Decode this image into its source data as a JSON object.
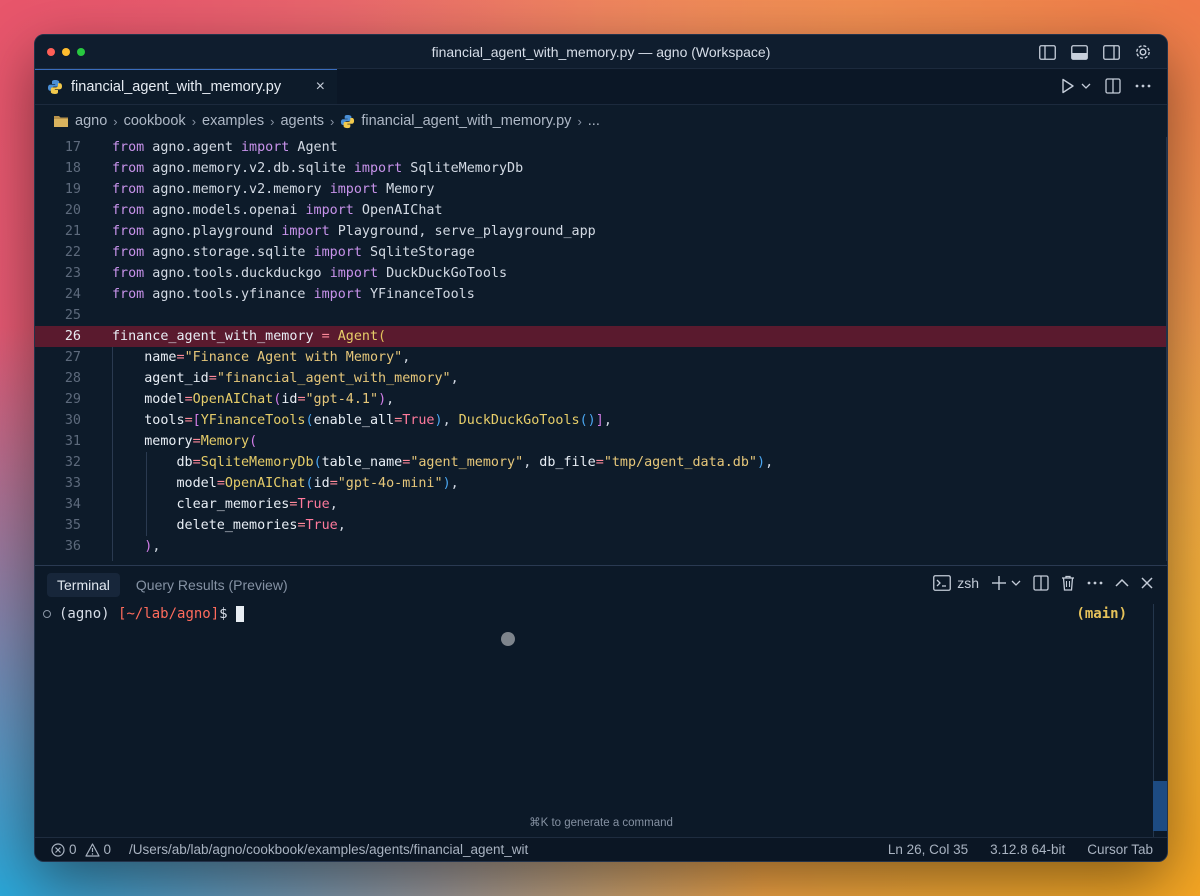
{
  "window": {
    "title": "financial_agent_with_memory.py — agno (Workspace)"
  },
  "tab": {
    "filename": "financial_agent_with_memory.py",
    "close": "×"
  },
  "breadcrumb": {
    "items": [
      "agno",
      "cookbook",
      "examples",
      "agents",
      "financial_agent_with_memory.py",
      "..."
    ]
  },
  "editor": {
    "active_line": 26,
    "lines": [
      {
        "n": "17"
      },
      {
        "n": "18"
      },
      {
        "n": "19"
      },
      {
        "n": "20"
      },
      {
        "n": "21"
      },
      {
        "n": "22"
      },
      {
        "n": "23"
      },
      {
        "n": "24"
      },
      {
        "n": "25"
      },
      {
        "n": "26"
      },
      {
        "n": "27"
      },
      {
        "n": "28"
      },
      {
        "n": "29"
      },
      {
        "n": "30"
      },
      {
        "n": "31"
      },
      {
        "n": "32"
      },
      {
        "n": "33"
      },
      {
        "n": "34"
      },
      {
        "n": "35"
      },
      {
        "n": "36"
      }
    ],
    "tokens": {
      "from": "from",
      "import": "import",
      "l17_mod": " agno.agent ",
      "l17_name": " Agent",
      "l18_mod": " agno.memory.v2.db.sqlite ",
      "l18_name": " SqliteMemoryDb",
      "l19_mod": " agno.memory.v2.memory ",
      "l19_name": " Memory",
      "l20_mod": " agno.models.openai ",
      "l20_name": " OpenAIChat",
      "l21_mod": " agno.playground ",
      "l21_name": " Playground, serve_playground_app",
      "l22_mod": " agno.storage.sqlite ",
      "l22_name": " SqliteStorage",
      "l23_mod": " agno.tools.duckduckgo ",
      "l23_name": " DuckDuckGoTools",
      "l24_mod": " agno.tools.yfinance ",
      "l24_name": " YFinanceTools",
      "l26_var": "finance_agent_with_memory",
      "l26_eq": " = ",
      "l26_fn": "Agent",
      "l26_paren": "(",
      "l27_k": "    name",
      "l27_v": "\"Finance Agent with Memory\"",
      "l28_k": "    agent_id",
      "l28_v": "\"financial_agent_with_memory\"",
      "l29_k": "    model",
      "l29_fn": "OpenAIChat",
      "l29_k2": "id",
      "l29_v": "\"gpt-4.1\"",
      "l30_k": "    tools",
      "l30_fn1": "YFinanceTools",
      "l30_k2": "enable_all",
      "l30_b": "True",
      "l30_fn2": " DuckDuckGoTools",
      "l31_k": "    memory",
      "l31_fn": "Memory",
      "l32_k": "        db",
      "l32_fn": "SqliteMemoryDb",
      "l32_k2": "table_name",
      "l32_v": "\"agent_memory\"",
      "l32_k3": " db_file",
      "l32_v2": "\"tmp/agent_data.db\"",
      "l33_k": "        model",
      "l33_fn": "OpenAIChat",
      "l33_k2": "id",
      "l33_v": "\"gpt-4o-mini\"",
      "l34_k": "        clear_memories",
      "l34_b": "True",
      "l35_k": "        delete_memories",
      "l35_b": "True",
      "l36_close": "    )"
    }
  },
  "panel": {
    "tabs": [
      "Terminal",
      "Query Results (Preview)"
    ],
    "shell": "zsh",
    "terminal": {
      "env": "(agno)",
      "path": "[~/lab/agno]",
      "prompt": "$",
      "branch": "(main)"
    },
    "hint": "⌘K to generate a command"
  },
  "status": {
    "errors": "0",
    "warnings": "0",
    "path": "/Users/ab/lab/agno/cookbook/examples/agents/financial_agent_wit",
    "position": "Ln 26, Col 35",
    "python": "3.12.8 64-bit",
    "mode": "Cursor Tab"
  },
  "colors": {
    "background": "#0d1b2a",
    "active_line": "#5a1a2e",
    "accent": "#3a6dbd"
  }
}
